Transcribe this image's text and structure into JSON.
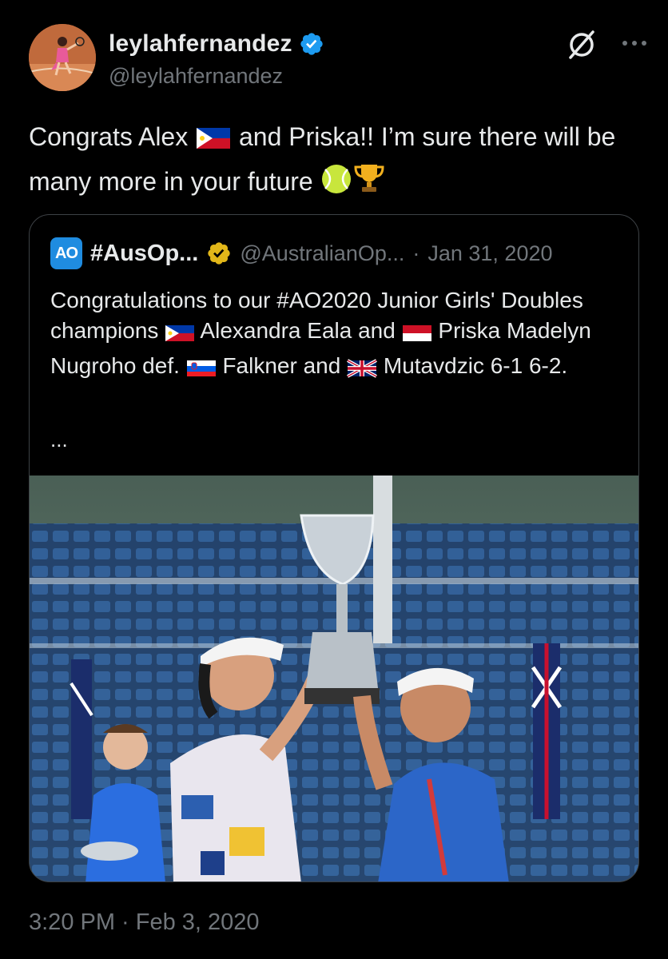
{
  "author": {
    "display_name": "leylahfernandez",
    "handle": "@leylahfernandez",
    "avatar_alt": "profile-photo-tennis"
  },
  "tweet": {
    "text_part1": "Congrats Alex ",
    "text_part2": " and Priska!! I’m sure there will be many more in your future ",
    "emojis": [
      "philippines-flag",
      "tennis-ball",
      "trophy"
    ],
    "timestamp": "3:20 PM · Feb 3, 2020"
  },
  "quoted": {
    "display_name": "#AusOp...",
    "handle": "@AustralianOp...",
    "separator": "·",
    "date": "Jan 31, 2020",
    "logo_text": "AO",
    "text_part1": "Congratulations to our #AO2020 Junior Girls' Doubles champions ",
    "text_part2": " Alexandra Eala and ",
    "text_part3": " Priska Madelyn Nugroho def. ",
    "text_part4": " Falkner and ",
    "text_part5": " Mutavdzic 6-1 6-2.",
    "ellipsis": "...",
    "photo_desc": "two-players-holding-trophy"
  },
  "icons": {
    "verified_blue": "#1d9bf0",
    "verified_gold": "#e2b719",
    "grok": "grok-icon",
    "more": "more-icon"
  }
}
